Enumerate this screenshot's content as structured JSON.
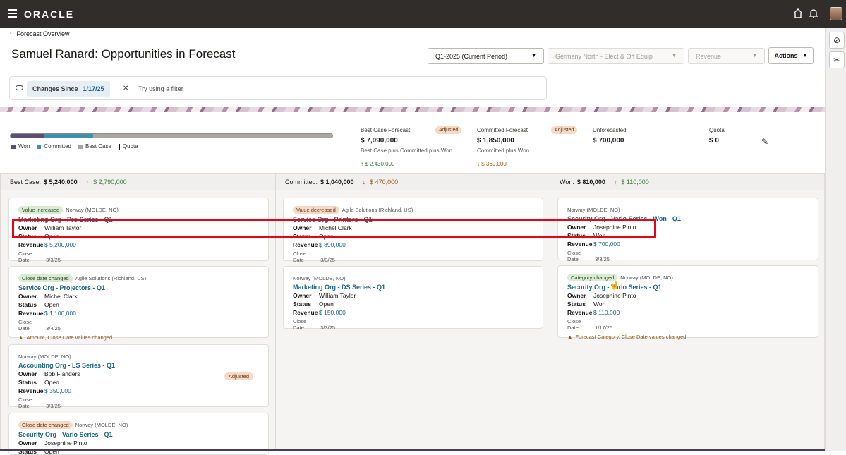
{
  "app": {
    "brand": "ORACLE"
  },
  "header": {
    "back_link": "Forecast Overview",
    "title": "Samuel Ranard: Opportunities in Forecast",
    "period_select": "Q1-2025 (Current Period)",
    "territory_select": "Germany North - Elect & Off Equip",
    "measure_select": "Revenue",
    "actions_label": "Actions"
  },
  "filter": {
    "chip_label": "Changes Since",
    "chip_value": "1/17/25",
    "hint": "Try using a filter"
  },
  "summary": {
    "progress": {
      "won": 0.106,
      "committed": 0.15,
      "best_case": 0.744
    },
    "legend": [
      "Won",
      "Committed",
      "Best Case",
      "Quota"
    ],
    "best_case": {
      "label": "Best Case Forecast",
      "badge": "Adjusted",
      "value": "$ 7,090,000",
      "sub": "Best Case plus Committed plus Won",
      "delta": "$ 2,430,000"
    },
    "committed": {
      "label": "Committed Forecast",
      "badge": "Adjusted",
      "value": "$ 1,850,000",
      "sub": "Committed plus Won",
      "delta": "$ 360,000"
    },
    "unforecasted": {
      "label": "Unforecasted",
      "value": "$ 700,000"
    },
    "quota": {
      "label": "Quota",
      "value": "$ 0"
    }
  },
  "columns": [
    {
      "label": "Best Case:",
      "total": "$ 5,240,000",
      "delta": "$ 2,790,000",
      "cards": [
        {
          "tag": "Value increased",
          "org": "Norway (MOLDE, NO)",
          "title": "Marketing Org - Pro Series - Q1",
          "owner": "William Taylor",
          "status": "Open",
          "revenue": "$ 5,200,000",
          "close": "3/3/25"
        },
        {
          "tag": "Close date changed",
          "org": "Agile Solutions (Richland, US)",
          "title": "Service Org - Projectors - Q1",
          "owner": "Michel Clark",
          "status": "Open",
          "revenue": "$ 1,100,000",
          "close": "3/4/25",
          "warning": "Amount, Close Date values changed"
        },
        {
          "org": "Norway (MOLDE, NO)",
          "title": "Accounting Org - LS Series - Q1",
          "owner": "Bob Flanders",
          "status": "Open",
          "revenue": "$ 350,000",
          "close": "3/3/25",
          "badge": "Adjusted"
        },
        {
          "tag": "Close date changed",
          "org": "Norway (MOLDE, NO)",
          "title": "Security Org - Vario Series - Q1",
          "owner": "Josephine Pinto",
          "status": "Open"
        }
      ]
    },
    {
      "label": "Committed:",
      "total": "$ 1,040,000",
      "delta": "$ 470,000",
      "cards": [
        {
          "tag": "Value decreased",
          "org": "Agile Solutions (Richland, US)",
          "title": "Service Org - Printers - Q1",
          "owner": "Michel Clark",
          "status": "Open",
          "revenue": "$ 890,000",
          "close": "3/3/25"
        },
        {
          "org": "Norway (MOLDE, NO)",
          "title": "Marketing Org - DS Series - Q1",
          "owner": "William Taylor",
          "status": "Open",
          "revenue": "$ 150,000",
          "close": "3/3/25"
        }
      ]
    },
    {
      "label": "Won:",
      "total": "$ 810,000",
      "delta": "$ 110,000",
      "cards": [
        {
          "org": "Norway (MOLDE, NO)",
          "title": "Security Org - Vario Series - Won - Q1",
          "owner": "Josephine Pinto",
          "status": "Won",
          "revenue": "$ 700,000",
          "close": "3/3/25"
        },
        {
          "tag": "Category changed",
          "org": "Norway (MOLDE, NO)",
          "title": "Security Org - Vario Series - Q1",
          "owner": "Josephine Pinto",
          "status": "Won",
          "revenue": "$ 110,000",
          "close": "1/17/25",
          "warning": "Forecast Category, Close Date values changed"
        }
      ]
    }
  ],
  "labels": {
    "owner": "Owner",
    "status": "Status",
    "revenue": "Revenue",
    "close_date": "Close Date"
  },
  "colors": {
    "won": "#5a4f72",
    "committed": "#3f8fae",
    "best_case": "#a8a5a2",
    "link": "#1b6586",
    "highlight": "#e1061a"
  }
}
